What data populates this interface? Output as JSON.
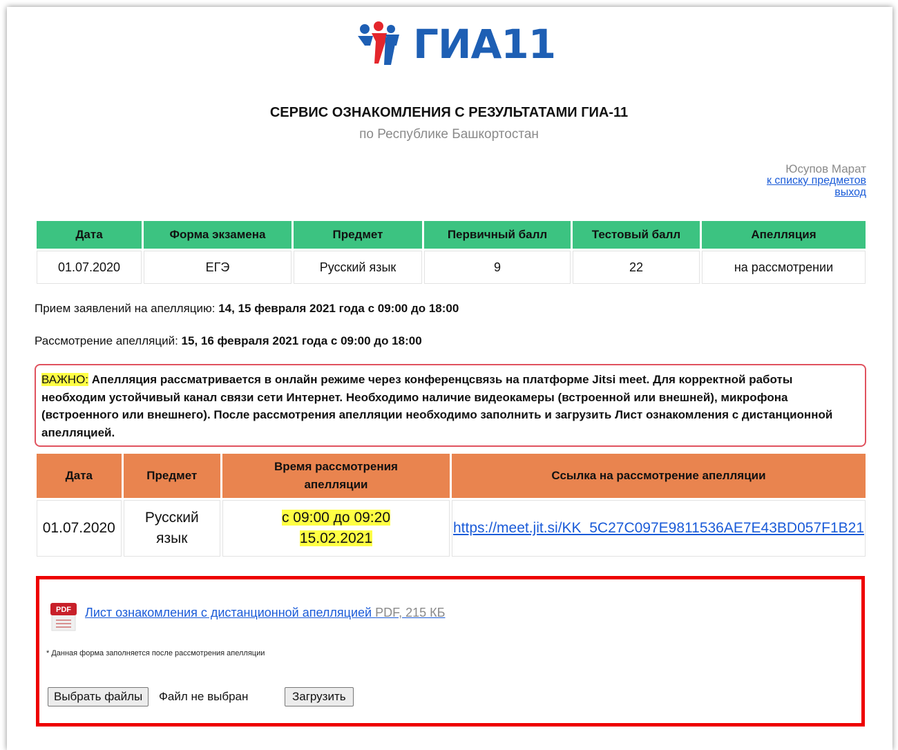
{
  "logo": {
    "text": "ГИА11",
    "icon": "gia-people-logo-icon",
    "colors": {
      "blue": "#1e5fb4",
      "red": "#e4262c"
    }
  },
  "header": {
    "title": "СЕРВИС ОЗНАКОМЛЕНИЯ С РЕЗУЛЬТАТАМИ ГИА-11",
    "subtitle": "по Республике Башкортостан"
  },
  "user": {
    "name": "Юсупов Марат",
    "subjects_link": "к списку предметов",
    "logout_link": "выход"
  },
  "results_table": {
    "headers": [
      "Дата",
      "Форма экзамена",
      "Предмет",
      "Первичный балл",
      "Тестовый балл",
      "Апелляция"
    ],
    "rows": [
      [
        "01.07.2020",
        "ЕГЭ",
        "Русский язык",
        "9",
        "22",
        "на рассмотрении"
      ]
    ],
    "header_color": "#3cc381"
  },
  "info": {
    "applications_label": "Прием заявлений на апелляцию:",
    "applications_value": "14, 15 февраля 2021 года с 09:00 до 18:00",
    "review_label": "Рассмотрение апелляций:",
    "review_value": "15, 16 февраля 2021 года с 09:00 до 18:00"
  },
  "important": {
    "label": "ВАЖНО:",
    "text": "Апелляция рассматривается в онлайн режиме через конференцсвязь на платформе Jitsi meet. Для корректной работы необходим устойчивый канал связи сети Интернет. Необходимо наличие видеокамеры (встроенной или внешней), микрофона (встроенного или внешнего). После рассмотрения апелляции необходимо заполнить и загрузить Лист ознакомления с дистанционной апелляцией."
  },
  "appeal_table": {
    "headers": [
      "Дата",
      "Предмет",
      "Время рассмотрения апелляции",
      "Ссылка на рассмотрение апелляции"
    ],
    "row": {
      "date": "01.07.2020",
      "subject": "Русский язык",
      "time": "с 09:00 до 09:20",
      "time_date": "15.02.2021",
      "link": "https://meet.jit.si/KK_5C27C097E9811536AE7E43BD057F1B21"
    },
    "header_color": "#e9844f"
  },
  "upload": {
    "doc_link": "Лист ознакомления с дистанционной апелляцией",
    "doc_meta": "PDF, 215 КБ",
    "pdf_icon_label": "PDF",
    "note": "* Данная форма заполняется после рассмотрения апелляции",
    "choose_files": "Выбрать файлы",
    "file_status": "Файл не выбран",
    "upload_button": "Загрузить",
    "border_color": "#ee0000"
  }
}
